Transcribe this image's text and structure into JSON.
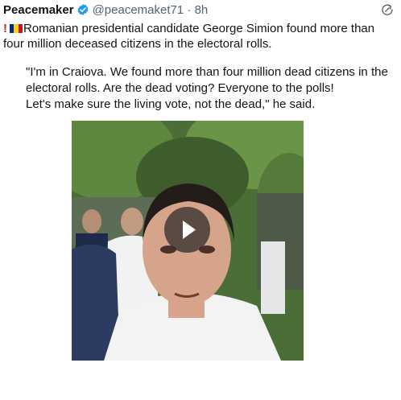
{
  "tweet": {
    "display_name": "Peacemaker",
    "handle": "@peacemaket71",
    "separator": "·",
    "time": "8h",
    "icons": {
      "verified": "verified-badge-icon",
      "share": "share-icon",
      "play": "play-icon"
    },
    "text_main": "Romanian presidential candidate George Simion  found more than four million deceased citizens in the electoral rolls.",
    "quote_lines": [
      "\"I'm in Craiova. We found more than four million dead citizens in the",
      "electoral rolls. Are the dead voting? Everyone to the polls!",
      "Let's make sure  the living vote, not the dead,\" he said."
    ]
  },
  "colors": {
    "verified": "#1d9bf0",
    "muted": "#536471",
    "alert": "#d61f26",
    "flag": [
      "#002b7f",
      "#fcd116",
      "#ce1126"
    ]
  }
}
